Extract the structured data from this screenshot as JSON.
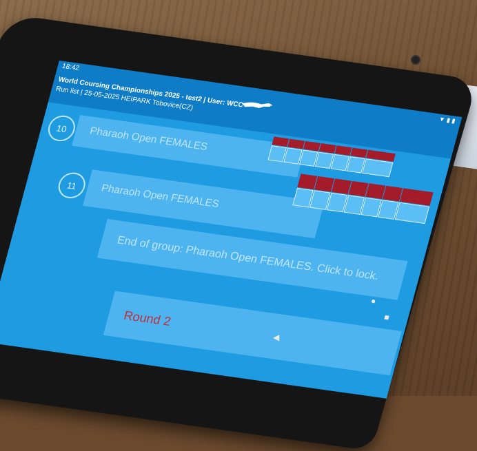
{
  "status": {
    "time": "18:42",
    "indicators": "▼ ▮ ▮"
  },
  "header": {
    "title": "World Coursing Championships 2025 - test2  |  User: WCC",
    "subtitle": "Run list | 25-05-2025 HEIPARK Tobovice(CZ)"
  },
  "runs": [
    {
      "number": "10",
      "label": "Pharaoh Open FEMALES"
    },
    {
      "number": "11",
      "label": "Pharaoh Open FEMALES"
    }
  ],
  "group_end": {
    "label": "End of group: Pharaoh Open FEMALES. Click to lock."
  },
  "round": {
    "label": "Round 2"
  },
  "nav": {
    "back": "◀",
    "home": "●",
    "recent": "■"
  },
  "colors": {
    "screen": "#1f9be2",
    "row": "#4db4f0",
    "score_red": "#a41b2a",
    "round_text": "#c0303a"
  }
}
